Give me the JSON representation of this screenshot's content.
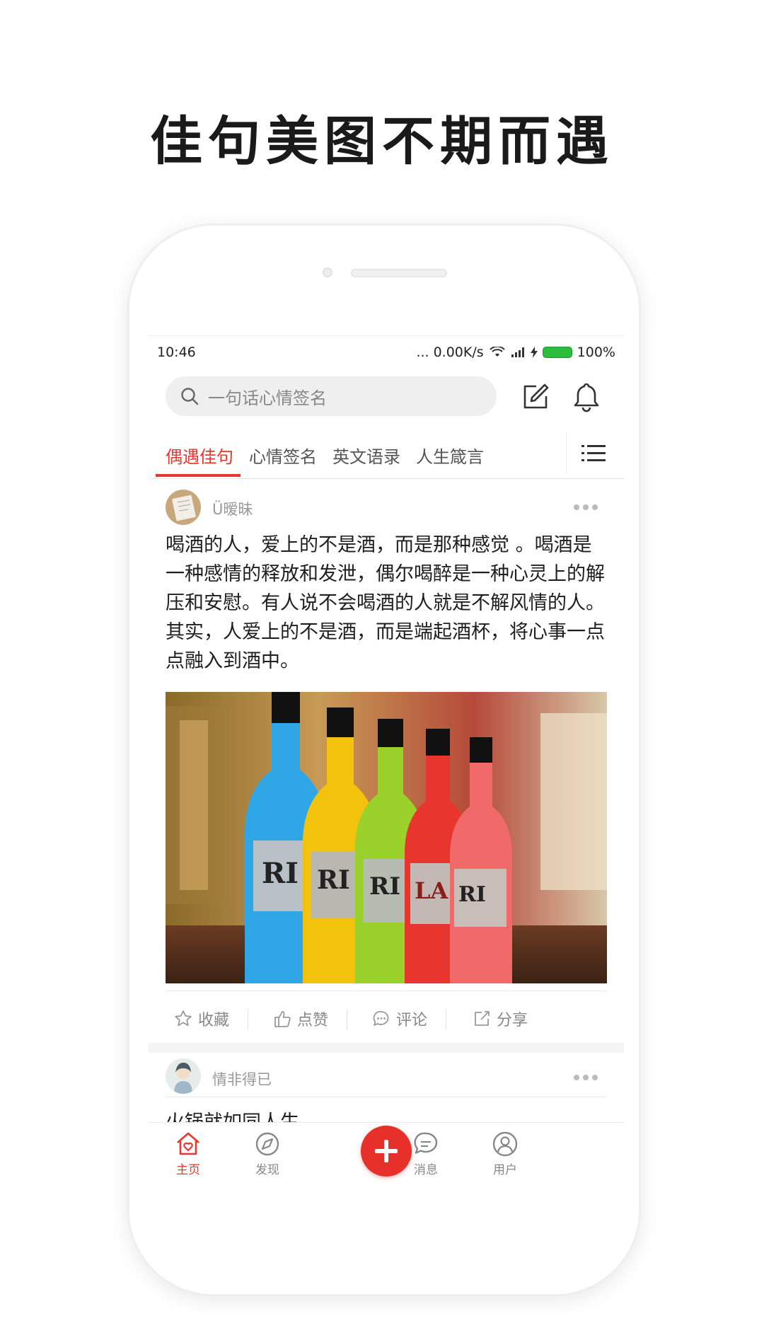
{
  "headline": "佳句美图不期而遇",
  "status": {
    "time": "10:46",
    "network": "... 0.00K/s",
    "battery": "100%"
  },
  "search": {
    "placeholder": "一句话心情签名"
  },
  "tabs": [
    {
      "label": "偶遇佳句",
      "active": true
    },
    {
      "label": "心情签名",
      "active": false
    },
    {
      "label": "英文语录",
      "active": false
    },
    {
      "label": "人生箴言",
      "active": false
    }
  ],
  "posts": [
    {
      "username": "Ü暧昧",
      "text": "喝酒的人，爱上的不是酒，而是那种感觉 。喝酒是一种感情的释放和发泄，偶尔喝醉是一种心灵上的解压和安慰。有人说不会喝酒的人就是不解风情的人。其实，人爱上的不是酒，而是端起酒杯，将心事一点点融入到酒中。",
      "image_labels": [
        "RI",
        "RI",
        "RI",
        "LA",
        "RI"
      ],
      "actions": {
        "favorite": "收藏",
        "like": "点赞",
        "comment": "评论",
        "share": "分享"
      }
    },
    {
      "username": "情非得已",
      "text": "火锅就如同人生"
    }
  ],
  "bottom_nav": {
    "home": "主页",
    "discover": "发现",
    "messages": "消息",
    "user": "用户"
  },
  "colors": {
    "accent": "#e8372e",
    "text": "#1e1e1e",
    "muted": "#888888"
  }
}
